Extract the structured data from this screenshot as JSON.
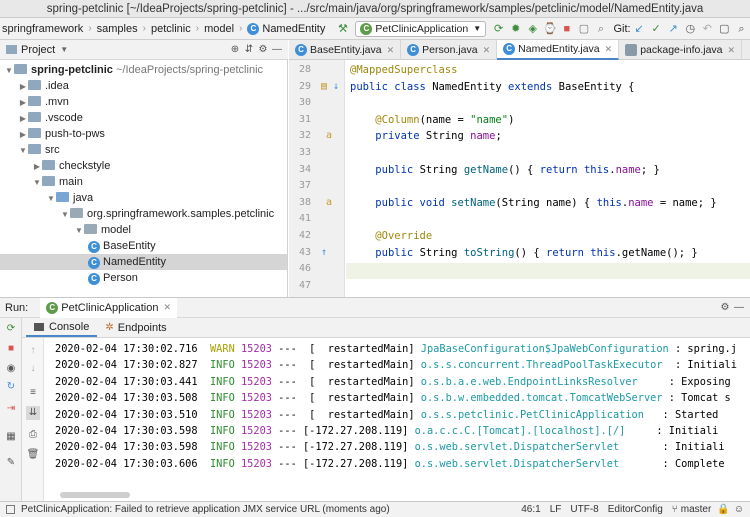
{
  "window": {
    "title": "spring-petclinic [~/IdeaProjects/spring-petclinic] - .../src/main/java/org/springframework/samples/petclinic/model/NamedEntity.java"
  },
  "nav": {
    "crumbs": [
      "springframework",
      "samples",
      "petclinic",
      "model",
      "NamedEntity"
    ],
    "run_config": "PetClinicApplication",
    "git_label": "Git:"
  },
  "project_panel": {
    "title": "Project",
    "tree": [
      {
        "label": "spring-petclinic",
        "extra": "~/IdeaProjects/spring-petclinic",
        "level": 0,
        "open": true,
        "kind": "root"
      },
      {
        "label": ".idea",
        "level": 1,
        "open": false,
        "kind": "folder"
      },
      {
        "label": ".mvn",
        "level": 1,
        "open": false,
        "kind": "folder"
      },
      {
        "label": ".vscode",
        "level": 1,
        "open": false,
        "kind": "folder"
      },
      {
        "label": "push-to-pws",
        "level": 1,
        "open": false,
        "kind": "folder"
      },
      {
        "label": "src",
        "level": 1,
        "open": true,
        "kind": "folder"
      },
      {
        "label": "checkstyle",
        "level": 2,
        "open": false,
        "kind": "folder"
      },
      {
        "label": "main",
        "level": 2,
        "open": true,
        "kind": "folder"
      },
      {
        "label": "java",
        "level": 3,
        "open": true,
        "kind": "src"
      },
      {
        "label": "org.springframework.samples.petclinic",
        "level": 4,
        "open": true,
        "kind": "pkg"
      },
      {
        "label": "model",
        "level": 5,
        "open": true,
        "kind": "pkg"
      },
      {
        "label": "BaseEntity",
        "level": 6,
        "kind": "class"
      },
      {
        "label": "NamedEntity",
        "level": 6,
        "kind": "class",
        "selected": true
      },
      {
        "label": "Person",
        "level": 6,
        "kind": "class"
      }
    ]
  },
  "editor": {
    "tabs": [
      {
        "label": "BaseEntity.java",
        "active": false
      },
      {
        "label": "Person.java",
        "active": false
      },
      {
        "label": "NamedEntity.java",
        "active": true
      },
      {
        "label": "package-info.java",
        "active": false
      }
    ],
    "line_numbers": [
      "28",
      "29",
      "30",
      "31",
      "32",
      "33",
      "34",
      "37",
      "38",
      "41",
      "42",
      "43",
      "46",
      "47"
    ],
    "lines": [
      [
        [
          "ann",
          "@MappedSuperclass"
        ]
      ],
      [
        [
          "kw",
          "public class "
        ],
        [
          "",
          "NamedEntity "
        ],
        [
          "kw",
          "extends "
        ],
        [
          "",
          "BaseEntity {"
        ]
      ],
      [],
      [
        [
          "",
          "    "
        ],
        [
          "ann",
          "@Column"
        ],
        [
          "",
          "(name = "
        ],
        [
          "str",
          "\"name\""
        ],
        [
          "",
          ")"
        ]
      ],
      [
        [
          "",
          "    "
        ],
        [
          "kw",
          "private "
        ],
        [
          "",
          "String "
        ],
        [
          "fld",
          "name"
        ],
        [
          "",
          ";"
        ]
      ],
      [],
      [
        [
          "",
          "    "
        ],
        [
          "kw",
          "public "
        ],
        [
          "",
          "String "
        ],
        [
          "fn",
          "getName"
        ],
        [
          "",
          "() { "
        ],
        [
          "kw",
          "return this"
        ],
        [
          "",
          "."
        ],
        [
          "fld",
          "name"
        ],
        [
          "",
          "; }"
        ]
      ],
      [],
      [
        [
          "",
          "    "
        ],
        [
          "kw",
          "public void "
        ],
        [
          "fn",
          "setName"
        ],
        [
          "",
          "(String name) { "
        ],
        [
          "kw",
          "this"
        ],
        [
          "",
          "."
        ],
        [
          "fld",
          "name"
        ],
        [
          "",
          " = name; }"
        ]
      ],
      [],
      [
        [
          "",
          "    "
        ],
        [
          "ann",
          "@Override"
        ]
      ],
      [
        [
          "",
          "    "
        ],
        [
          "kw",
          "public "
        ],
        [
          "",
          "String "
        ],
        [
          "fn",
          "toString"
        ],
        [
          "",
          "() { "
        ],
        [
          "kw",
          "return this"
        ],
        [
          "",
          ".getName(); }"
        ]
      ],
      [],
      []
    ]
  },
  "run_panel": {
    "label": "Run:",
    "config": "PetClinicApplication",
    "tabs": [
      "Console",
      "Endpoints"
    ],
    "log": [
      {
        "ts": "2020-02-04 17:30:02.716",
        "level": "WARN",
        "pid": "15203",
        "thread": "---  [  restartedMain]",
        "logger": "JpaBaseConfiguration$JpaWebConfiguration",
        "msg": " : spring.j"
      },
      {
        "ts": "2020-02-04 17:30:02.827",
        "level": "INFO",
        "pid": "15203",
        "thread": "---  [  restartedMain]",
        "logger": "o.s.s.concurrent.ThreadPoolTaskExecutor ",
        "msg": " : Initiali"
      },
      {
        "ts": "2020-02-04 17:30:03.441",
        "level": "INFO",
        "pid": "15203",
        "thread": "---  [  restartedMain]",
        "logger": "o.s.b.a.e.web.EndpointLinksResolver    ",
        "msg": " : Exposing"
      },
      {
        "ts": "2020-02-04 17:30:03.508",
        "level": "INFO",
        "pid": "15203",
        "thread": "---  [  restartedMain]",
        "logger": "o.s.b.w.embedded.tomcat.TomcatWebServer",
        "msg": " : Tomcat s"
      },
      {
        "ts": "2020-02-04 17:30:03.510",
        "level": "INFO",
        "pid": "15203",
        "thread": "---  [  restartedMain]",
        "logger": "o.s.s.petclinic.PetClinicApplication  ",
        "msg": " : Started"
      },
      {
        "ts": "2020-02-04 17:30:03.598",
        "level": "INFO",
        "pid": "15203",
        "thread": "--- [-172.27.208.119]",
        "logger": "o.a.c.c.C.[Tomcat].[localhost].[/]    ",
        "msg": " : Initiali"
      },
      {
        "ts": "2020-02-04 17:30:03.598",
        "level": "INFO",
        "pid": "15203",
        "thread": "--- [-172.27.208.119]",
        "logger": "o.s.web.servlet.DispatcherServlet      ",
        "msg": " : Initiali"
      },
      {
        "ts": "2020-02-04 17:30:03.606",
        "level": "INFO",
        "pid": "15203",
        "thread": "--- [-172.27.208.119]",
        "logger": "o.s.web.servlet.DispatcherServlet      ",
        "msg": " : Complete"
      }
    ]
  },
  "status": {
    "message": "PetClinicApplication: Failed to retrieve application JMX service URL (moments ago)",
    "position": "46:1",
    "line_sep": "LF",
    "encoding": "UTF-8",
    "editorconfig": "EditorConfig",
    "branch": "master"
  }
}
